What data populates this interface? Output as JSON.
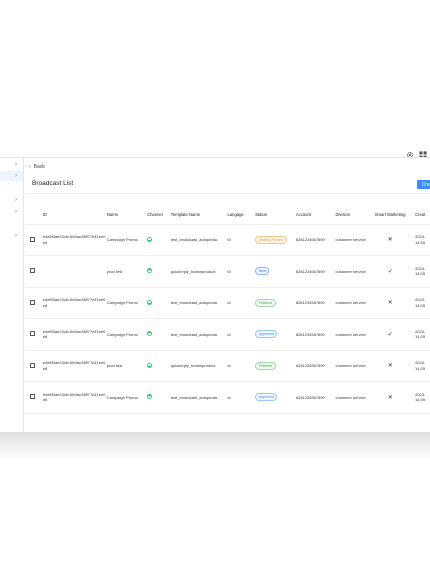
{
  "toolbar": {
    "settings_icon": "gear-icon",
    "apps_icon": "grid-icon"
  },
  "sidebar": {
    "items": [
      {
        "icon": "chevron-right-icon"
      },
      {
        "icon": "chevron-right-icon",
        "active": true
      },
      {
        "icon": "chevron-right-icon"
      },
      {
        "icon": "chevron-right-icon"
      },
      {
        "icon": "chevron-right-icon"
      }
    ]
  },
  "main": {
    "back_label": "Back",
    "title": "Broadcast List",
    "create_label": "Crea",
    "columns": [
      "",
      "ID",
      "Name",
      "Channel",
      "Template Name",
      "Langage",
      "Status",
      "Account",
      "Division",
      "Smart Marketing",
      "Creat"
    ],
    "rows": [
      {
        "id": "e4e8f3ae23cfc1fe9ac28ff77e41ee0e8",
        "name": "Campaign Promo",
        "channel": "whatsapp",
        "template": "test_broadcast_autopedia",
        "lang": "id",
        "status": "Waiting Review",
        "status_type": "waiting",
        "account": "6281234567890",
        "division": "customer service",
        "smart": "✕",
        "date": [
          "2024-",
          "14:05"
        ]
      },
      {
        "id": "",
        "name": "prod test",
        "channel": "whatsapp",
        "template": "quickreply_buttonproduct",
        "lang": "id",
        "status": "New",
        "status_type": "new",
        "account": "6281234567890",
        "division": "customer service",
        "smart": "✓",
        "date": [
          "2024-",
          "14:05"
        ]
      },
      {
        "id": "e4e8f3ae23cfc1fe9ac28ff77e41ee0e8",
        "name": "Campaign Promo",
        "channel": "whatsapp",
        "template": "test_broadcast_autopedia",
        "lang": "id",
        "status": "Finished",
        "status_type": "finished",
        "account": "6281234567890",
        "division": "customer service",
        "smart": "✕",
        "date": [
          "2024-",
          "14:05"
        ]
      },
      {
        "id": "e4e8f3ae23cfc1fe9ac28ff77e41ee0e8",
        "name": "Campaign Promo",
        "channel": "whatsapp",
        "template": "test_broadcast_autopedia",
        "lang": "id",
        "status": "Approved",
        "status_type": "approved",
        "account": "6281234567890",
        "division": "customer service",
        "smart": "✓",
        "date": [
          "2024-",
          "14:05"
        ]
      },
      {
        "id": "e4e8f3ae23cfc1fe9ac28ff77e41ee0e8",
        "name": "prod test",
        "channel": "whatsapp",
        "template": "quickreply_buttonproduct",
        "lang": "id",
        "status": "Finished",
        "status_type": "finished",
        "account": "6281234567890",
        "division": "customer service",
        "smart": "✕",
        "date": [
          "2024-",
          "14:05"
        ]
      },
      {
        "id": "e4e8f3ae23cfc1fe9ac28ff77e41ee0e8",
        "name": "Campaign Promo",
        "channel": "whatsapp",
        "template": "test_broadcast_autopedia",
        "lang": "id",
        "status": "Approved",
        "status_type": "approved",
        "account": "6281234567890",
        "division": "customer service",
        "smart": "✕",
        "date": [
          "2023-",
          "14:05"
        ]
      }
    ]
  }
}
